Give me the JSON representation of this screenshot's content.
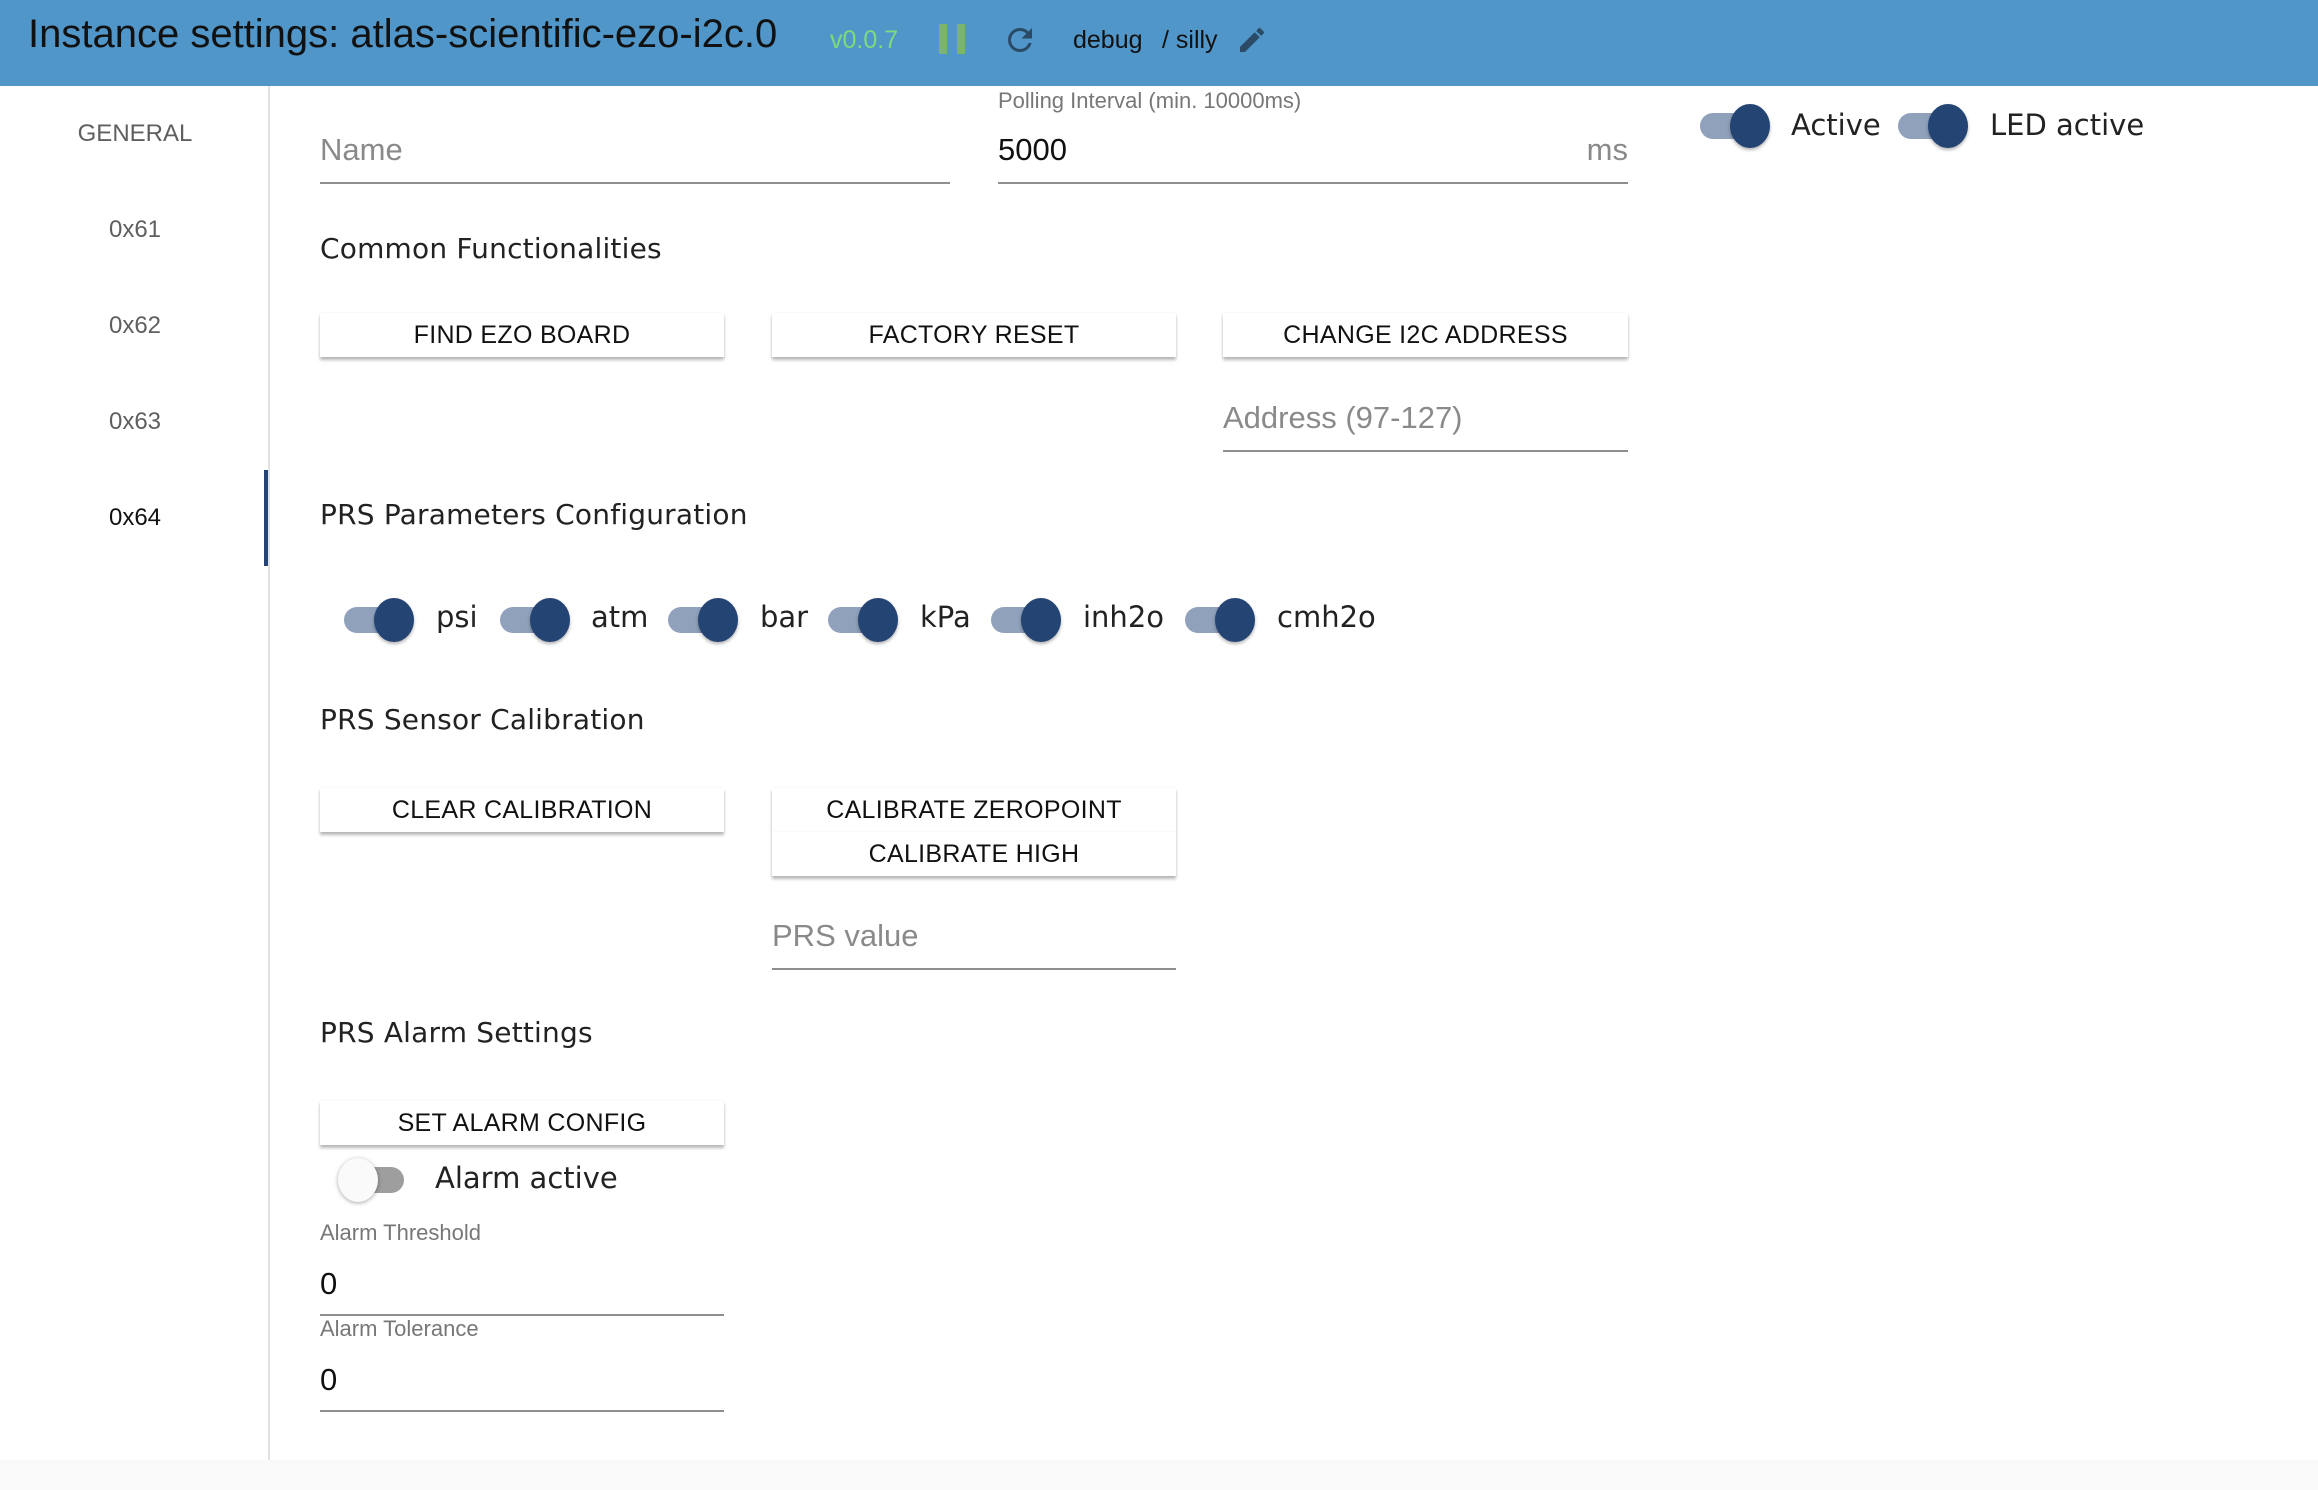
{
  "header": {
    "title": "Instance settings: atlas-scientific-ezo-i2c.0",
    "version": "v0.0.7",
    "log_level": "debug",
    "log_level_secondary": "/ silly",
    "icons": {
      "pause": "pause-icon",
      "refresh": "refresh-icon",
      "edit": "pencil-icon"
    },
    "colors": {
      "background": "#5196c9",
      "version": "#7ddb7d",
      "pause": "#7ab46f"
    }
  },
  "sidebar": {
    "tabs": [
      {
        "label": "GENERAL",
        "active": false
      },
      {
        "label": "0x61",
        "active": false
      },
      {
        "label": "0x62",
        "active": false
      },
      {
        "label": "0x63",
        "active": false
      },
      {
        "label": "0x64",
        "active": true
      }
    ],
    "active_color": "#244474"
  },
  "general": {
    "name": {
      "placeholder": "Name",
      "value": ""
    },
    "polling": {
      "label": "Polling Interval (min. 10000ms)",
      "value": "5000",
      "suffix": "ms"
    },
    "toggles": [
      {
        "label": "Active",
        "checked": true
      },
      {
        "label": "LED active",
        "checked": true
      }
    ]
  },
  "common": {
    "title": "Common Functionalities",
    "buttons": [
      "Find EZO Board",
      "Factory Reset",
      "Change I2C Address"
    ],
    "address": {
      "placeholder": "Address (97-127)",
      "value": ""
    }
  },
  "parameters": {
    "title": "PRS Parameters Configuration",
    "units": [
      {
        "label": "psi",
        "checked": true
      },
      {
        "label": "atm",
        "checked": true
      },
      {
        "label": "bar",
        "checked": true
      },
      {
        "label": "kPa",
        "checked": true
      },
      {
        "label": "inh2o",
        "checked": true
      },
      {
        "label": "cmh2o",
        "checked": true
      }
    ]
  },
  "calibration": {
    "title": "PRS Sensor Calibration",
    "clear_label": "Clear Calibration",
    "zeropoint_label": "Calibrate Zeropoint",
    "high_label": "Calibrate High",
    "prs_value": {
      "placeholder": "PRS value",
      "value": ""
    }
  },
  "alarm": {
    "title": "PRS Alarm Settings",
    "set_label": "Set Alarm Config",
    "active": {
      "label": "Alarm active",
      "checked": false
    },
    "threshold": {
      "label": "Alarm Threshold",
      "value": "0"
    },
    "tolerance": {
      "label": "Alarm Tolerance",
      "value": "0"
    }
  }
}
